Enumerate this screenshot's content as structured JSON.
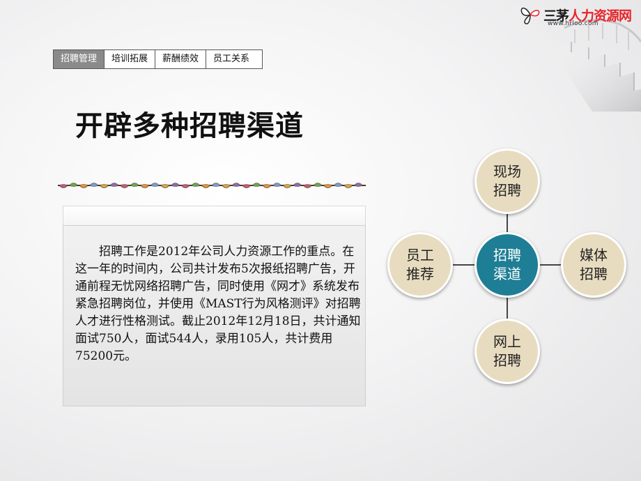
{
  "logo": {
    "name_part1": "三茅",
    "name_part2": "人力资源网",
    "url": "www.hrloo.com"
  },
  "tabs": [
    {
      "label": "招聘管理",
      "active": true
    },
    {
      "label": "培训拓展",
      "active": false
    },
    {
      "label": "薪酬绩效",
      "active": false
    },
    {
      "label": "员工关系",
      "active": false
    }
  ],
  "title": "开辟多种招聘渠道",
  "content": {
    "paragraph": "招聘工作是2012年公司人力资源工作的重点。在这一年的时间内，公司共计发布5次报纸招聘广告，开通前程无忧网络招聘广告，同时使用《网才》系统发布紧急招聘岗位，并使用《MAST行为风格测评》对招聘人才进行性格测试。截止2012年12月18日，共计通知面试750人，面试544人，录用105人，共计费用75200元。"
  },
  "diagram": {
    "center": "招聘渠道",
    "top": "现场招聘",
    "right": "媒体招聘",
    "bottom": "网上招聘",
    "left": "员工推荐"
  },
  "colors": {
    "center_node": "#1e7e95",
    "outer_node": "#e8dcc0",
    "active_tab": "#8a8a8a"
  }
}
